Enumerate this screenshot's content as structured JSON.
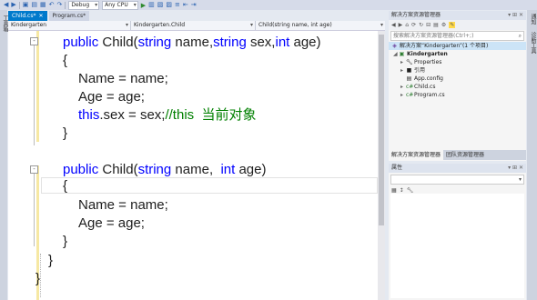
{
  "toolbar": {
    "config": "Debug",
    "platform": "Any CPU",
    "start_label": "▶"
  },
  "toolbox": {
    "label": "工具箱"
  },
  "tabs": [
    {
      "label": "Child.cs*",
      "active": true
    },
    {
      "label": "Program.cs*",
      "active": false
    }
  ],
  "navbar": {
    "project": "Kindergarten",
    "type": "Kindergarten.Child",
    "member": "Child(string name, int age)"
  },
  "code": {
    "line1": {
      "kw1": "public",
      "t1": " Child(",
      "kw2": "string",
      "t2": " name,",
      "kw3": "string",
      "t3": " sex,",
      "kw4": "int",
      "t4": " age)"
    },
    "line2": "{",
    "line3": "Name = name;",
    "line4": "Age = age;",
    "line5": {
      "kw": "this",
      "t": ".sex = sex;",
      "cm": "//this  当前对象"
    },
    "line6": "}",
    "line7": {
      "kw1": "public",
      "t1": " Child(",
      "kw2": "string",
      "t2": " name,  ",
      "kw3": "int",
      "t3": " age)"
    },
    "line8": "{",
    "line9": "Name = name;",
    "line10": "Age = age;",
    "line11": "}",
    "line12": "}",
    "line13": "}"
  },
  "solution_explorer": {
    "title": "解决方案资源管理器",
    "search_placeholder": "搜索解决方案资源管理器(Ctrl+;)",
    "items": {
      "solution": "解决方案“Kindergarten”(1 个项目)",
      "project": "Kindergarten",
      "properties": "Properties",
      "references": "引用",
      "appconfig": "App.config",
      "child": "Child.cs",
      "program": "Program.cs"
    },
    "bottom_tabs": [
      "解决方案资源管理器",
      "团队资源管理器"
    ]
  },
  "properties": {
    "title": "属性"
  },
  "right_strip": {
    "label1": "通知",
    "label2": "诊断工具"
  },
  "colors": {
    "accent": "#007acc",
    "keyword": "#0000ff",
    "comment": "#008000"
  }
}
